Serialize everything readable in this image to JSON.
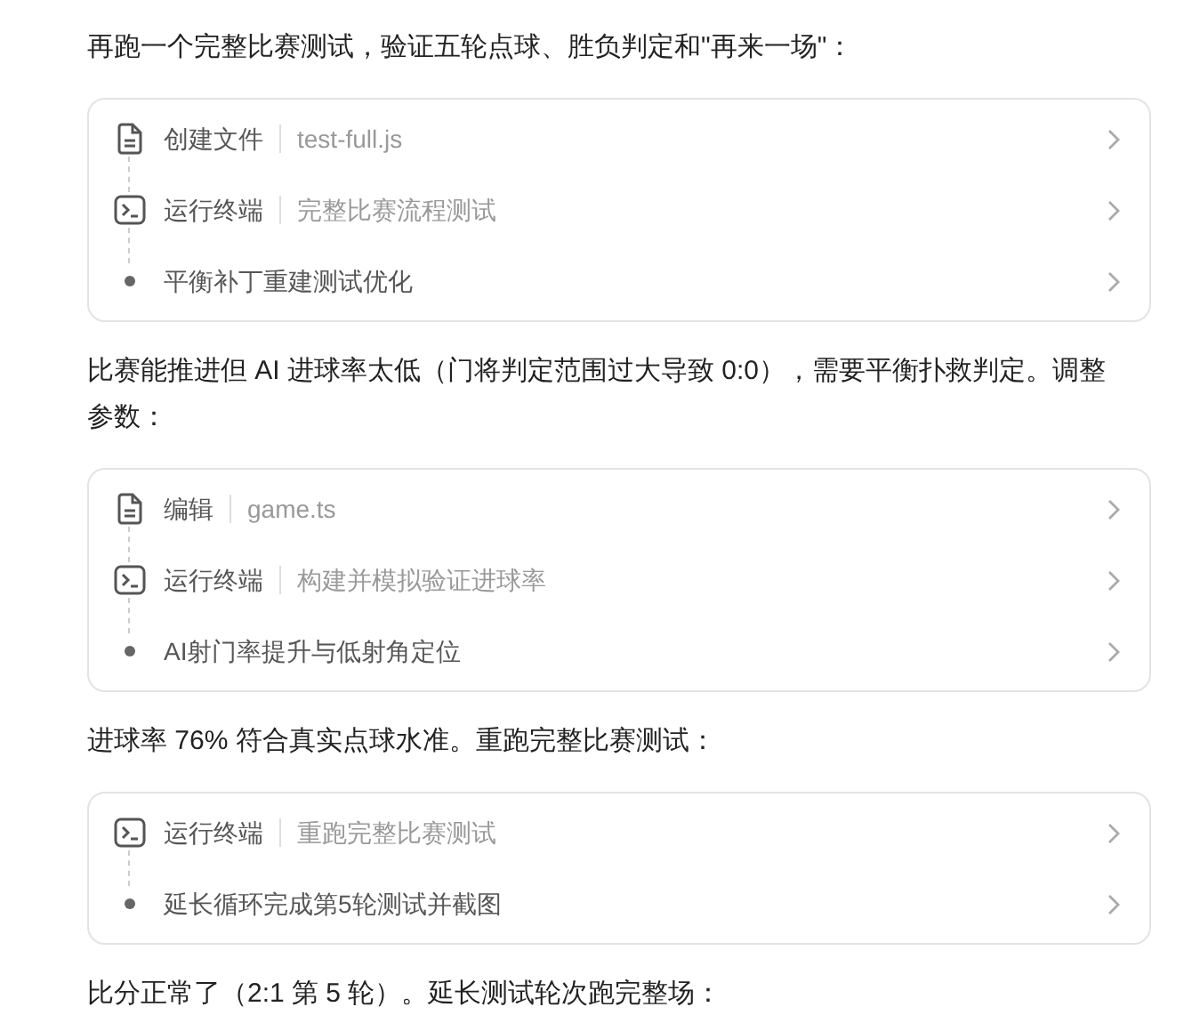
{
  "blocks": [
    {
      "kind": "paragraph",
      "text": "再跑一个完整比赛测试，验证五轮点球、胜负判定和\"再来一场\"："
    },
    {
      "kind": "steps",
      "steps": [
        {
          "kind": "file",
          "label": "创建文件",
          "detail": "test-full.js"
        },
        {
          "kind": "terminal",
          "label": "运行终端",
          "detail": "完整比赛流程测试"
        },
        {
          "kind": "bullet",
          "label": "平衡补丁重建测试优化"
        }
      ]
    },
    {
      "kind": "paragraph",
      "text": "比赛能推进但 AI 进球率太低（门将判定范围过大导致 0:0），需要平衡扑救判定。调整参数："
    },
    {
      "kind": "steps",
      "steps": [
        {
          "kind": "file",
          "label": "编辑",
          "detail": "game.ts"
        },
        {
          "kind": "terminal",
          "label": "运行终端",
          "detail": "构建并模拟验证进球率"
        },
        {
          "kind": "bullet",
          "label": "AI射门率提升与低射角定位"
        }
      ]
    },
    {
      "kind": "paragraph",
      "text": "进球率 76% 符合真实点球水准。重跑完整比赛测试："
    },
    {
      "kind": "steps",
      "steps": [
        {
          "kind": "terminal",
          "label": "运行终端",
          "detail": "重跑完整比赛测试"
        },
        {
          "kind": "bullet",
          "label": "延长循环完成第5轮测试并截图"
        }
      ]
    },
    {
      "kind": "paragraph",
      "text": "比分正常了（2:1 第 5 轮）。延长测试轮次跑完整场："
    }
  ]
}
